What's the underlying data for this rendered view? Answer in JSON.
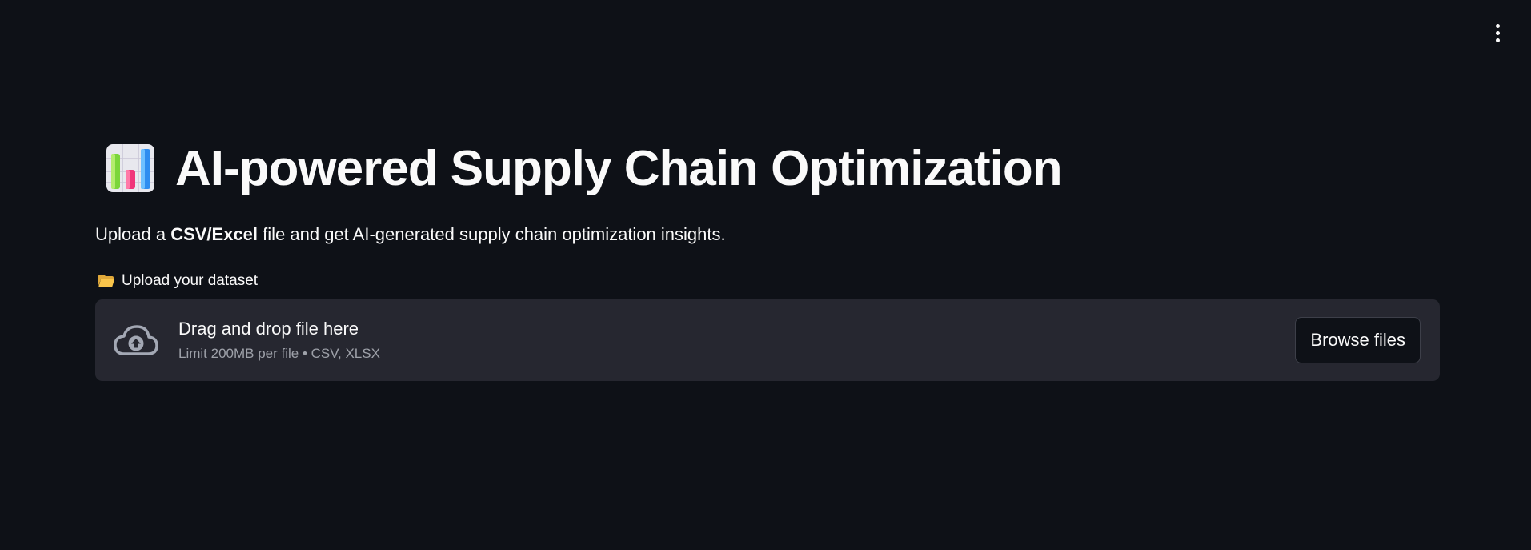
{
  "menu": {
    "icon": "more-vertical-icon"
  },
  "header": {
    "icon": "bar-chart-emoji-icon",
    "title": "AI-powered Supply Chain Optimization"
  },
  "intro": {
    "prefix": "Upload a ",
    "bold": "CSV/Excel",
    "suffix": " file and get AI-generated supply chain optimization insights."
  },
  "uploader": {
    "label_icon": "open-folder-icon",
    "label": "Upload your dataset",
    "dropzone_icon": "cloud-upload-icon",
    "dropzone_title": "Drag and drop file here",
    "dropzone_limit": "Limit 200MB per file • CSV, XLSX",
    "browse_label": "Browse files"
  },
  "colors": {
    "background": "#0e1117",
    "dropzone_bg": "#262730",
    "text": "#fafafa",
    "muted_text": "#9ea1a9"
  }
}
